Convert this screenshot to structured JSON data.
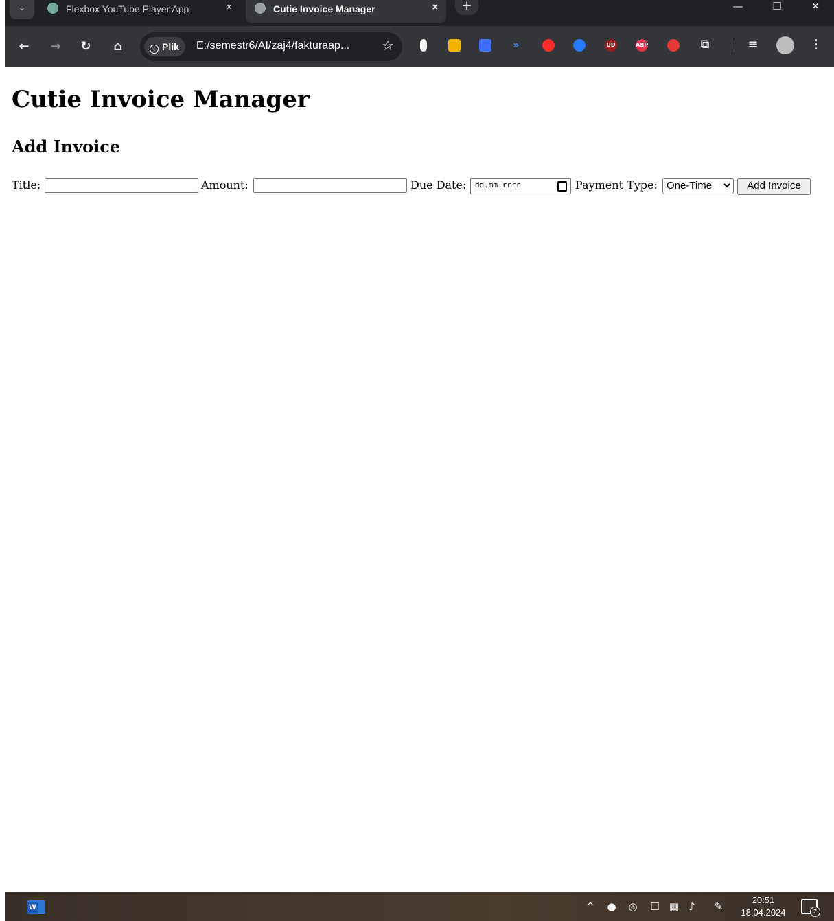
{
  "browser": {
    "tabs": [
      {
        "title": "Flexbox YouTube Player App",
        "active": false
      },
      {
        "title": "Cutie Invoice Manager",
        "active": true
      }
    ],
    "tab_close_glyph": "×",
    "new_tab_glyph": "+",
    "address": {
      "chip": "Plik",
      "url": "E:/semestr6/AI/zaj4/fakturaap..."
    },
    "extension_labels": {
      "ud": "UD",
      "abp": "ABP"
    }
  },
  "page": {
    "title": "Cutie Invoice Manager",
    "section_heading": "Add Invoice",
    "form": {
      "title_label": "Title:",
      "title_value": "",
      "amount_label": "Amount:",
      "amount_value": "",
      "due_date_label": "Due Date:",
      "due_date_placeholder": "dd.mm.rrrr",
      "payment_type_label": "Payment Type:",
      "payment_type_selected": "One-Time",
      "submit_label": "Add Invoice"
    }
  },
  "taskbar": {
    "time": "20:51",
    "date": "18.04.2024",
    "notifications": "2"
  },
  "colors": {
    "chrome_dark": "#202124",
    "toolbar": "#35363a",
    "page_bg": "#ffffff",
    "taskbar": "#43362b"
  }
}
